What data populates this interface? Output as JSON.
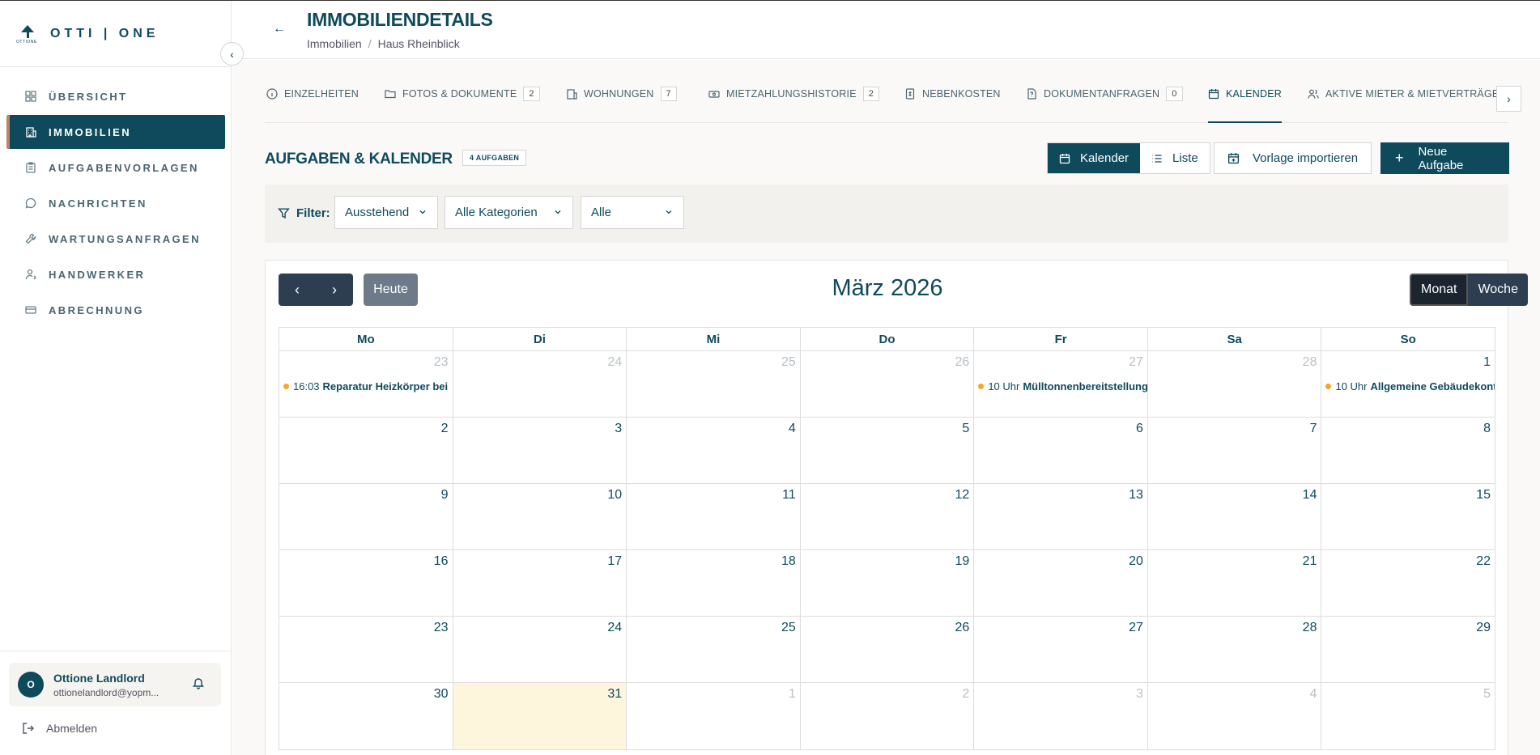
{
  "brand": {
    "name": "OTTI | ONE",
    "mark_text": "OTTIONE"
  },
  "sidebar": {
    "items": [
      {
        "label": "ÜBERSICHT",
        "icon": "grid-icon",
        "active": false
      },
      {
        "label": "IMMOBILIEN",
        "icon": "building-icon",
        "active": true
      },
      {
        "label": "AUFGABENVORLAGEN",
        "icon": "clipboard-icon",
        "active": false
      },
      {
        "label": "NACHRICHTEN",
        "icon": "chat-icon",
        "active": false
      },
      {
        "label": "WARTUNGSANFRAGEN",
        "icon": "wrench-icon",
        "active": false
      },
      {
        "label": "HANDWERKER",
        "icon": "user-tool-icon",
        "active": false
      },
      {
        "label": "ABRECHNUNG",
        "icon": "card-icon",
        "active": false
      }
    ],
    "user": {
      "initial": "O",
      "name": "Ottione Landlord",
      "email": "ottionelandlord@yopm..."
    },
    "logout_label": "Abmelden"
  },
  "header": {
    "title": "IMMOBILIENDETAILS",
    "breadcrumb": [
      "Immobilien",
      "Haus Rheinblick"
    ]
  },
  "tabs": [
    {
      "label": "EINZELHEITEN",
      "badge": null
    },
    {
      "label": "FOTOS & DOKUMENTE",
      "badge": "2"
    },
    {
      "label": "WOHNUNGEN",
      "badge": "7"
    },
    {
      "label": "MIETZAHLUNGSHISTORIE",
      "badge": "2"
    },
    {
      "label": "NEBENKOSTEN",
      "badge": null
    },
    {
      "label": "DOKUMENTANFRAGEN",
      "badge": "0"
    },
    {
      "label": "KALENDER",
      "badge": null
    },
    {
      "label": "AKTIVE MIETER & MIETVERTRÄGE",
      "badge": null
    }
  ],
  "section": {
    "title": "AUFGABEN & KALENDER",
    "count_label": "4 AUFGABEN",
    "view_calendar": "Kalender",
    "view_list": "Liste",
    "import_label": "Vorlage importieren",
    "new_task_label": "Neue Aufgabe"
  },
  "filters": {
    "label": "Filter:",
    "status": "Ausstehend",
    "category": "Alle Kategorien",
    "assignee": "Alle"
  },
  "calendar": {
    "title": "März 2026",
    "today_label": "Heute",
    "month_label": "Monat",
    "week_label": "Woche",
    "weekdays": [
      "Mo",
      "Di",
      "Mi",
      "Do",
      "Fr",
      "Sa",
      "So"
    ],
    "weeks": [
      [
        {
          "num": "23",
          "other": true,
          "event_time": "16:03",
          "event_title": "Reparatur Heizkörper bei"
        },
        {
          "num": "24",
          "other": true
        },
        {
          "num": "25",
          "other": true
        },
        {
          "num": "26",
          "other": true
        },
        {
          "num": "27",
          "other": true,
          "event_time": "10 Uhr",
          "event_title": "Mülltonnenbereitstellung"
        },
        {
          "num": "28",
          "other": true
        },
        {
          "num": "1",
          "other": false,
          "event_time": "10 Uhr",
          "event_title": "Allgemeine Gebäudekontrolle"
        }
      ],
      [
        {
          "num": "2"
        },
        {
          "num": "3"
        },
        {
          "num": "4"
        },
        {
          "num": "5"
        },
        {
          "num": "6"
        },
        {
          "num": "7"
        },
        {
          "num": "8"
        }
      ],
      [
        {
          "num": "9"
        },
        {
          "num": "10"
        },
        {
          "num": "11"
        },
        {
          "num": "12"
        },
        {
          "num": "13"
        },
        {
          "num": "14"
        },
        {
          "num": "15"
        }
      ],
      [
        {
          "num": "16"
        },
        {
          "num": "17"
        },
        {
          "num": "18"
        },
        {
          "num": "19"
        },
        {
          "num": "20"
        },
        {
          "num": "21"
        },
        {
          "num": "22"
        }
      ],
      [
        {
          "num": "23"
        },
        {
          "num": "24"
        },
        {
          "num": "25"
        },
        {
          "num": "26"
        },
        {
          "num": "27"
        },
        {
          "num": "28"
        },
        {
          "num": "29"
        }
      ],
      [
        {
          "num": "30"
        },
        {
          "num": "31",
          "today": true
        },
        {
          "num": "1",
          "other": true
        },
        {
          "num": "2",
          "other": true
        },
        {
          "num": "3",
          "other": true
        },
        {
          "num": "4",
          "other": true
        },
        {
          "num": "5",
          "other": true
        }
      ]
    ]
  },
  "colors": {
    "primary": "#0f4a5c",
    "accent": "#b8866b",
    "event_dot": "#f5a623",
    "today_bg": "#fdf6dc"
  }
}
